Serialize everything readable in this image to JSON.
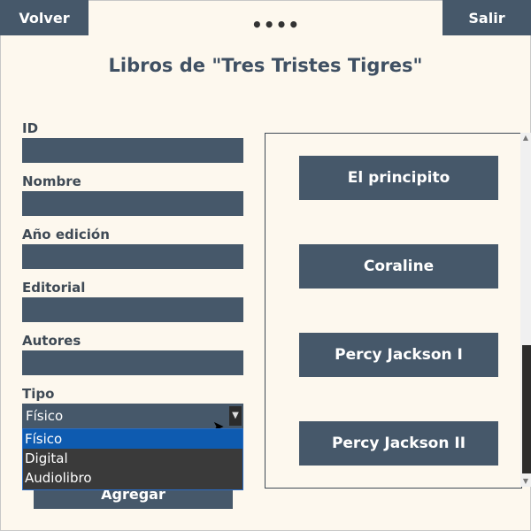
{
  "header": {
    "back_label": "Volver",
    "exit_label": "Salir",
    "menu_dots": "••••"
  },
  "page": {
    "title": "Libros de \"Tres Tristes Tigres\""
  },
  "form": {
    "fields": [
      {
        "label": "ID",
        "value": ""
      },
      {
        "label": "Nombre",
        "value": ""
      },
      {
        "label": "Año edición",
        "value": ""
      },
      {
        "label": "Editorial",
        "value": ""
      },
      {
        "label": "Autores",
        "value": ""
      }
    ],
    "tipo_label": "Tipo",
    "tipo_selected": "Físico",
    "tipo_options": [
      "Físico",
      "Digital",
      "Audiolibro"
    ],
    "submit_label": "Agregar"
  },
  "books": [
    "El principito",
    "Coraline",
    "Percy Jackson I",
    "Percy Jackson II"
  ],
  "colors": {
    "accent": "#46586a",
    "background": "#fdf8ee",
    "selected_option": "#0e5bb0"
  }
}
